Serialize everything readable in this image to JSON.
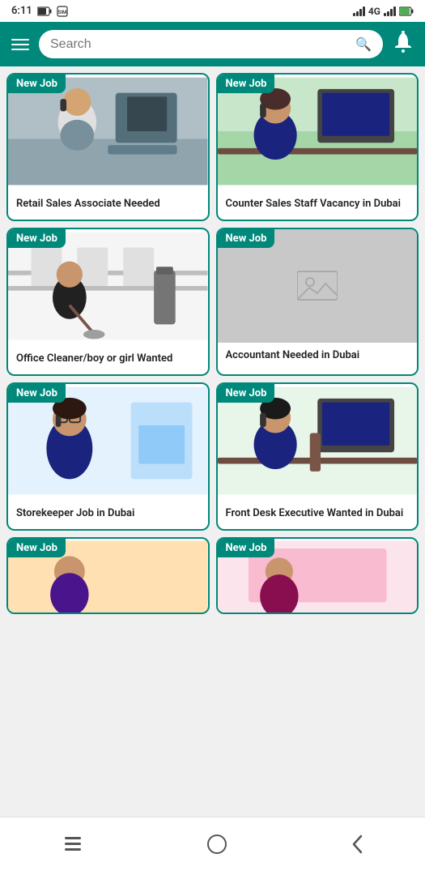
{
  "statusBar": {
    "time": "6:11",
    "signal": "4G"
  },
  "header": {
    "searchPlaceholder": "Search",
    "notificationBell": "bell-icon"
  },
  "jobs": [
    {
      "id": 1,
      "badge": "New Job",
      "title": "Retail Sales Associate Needed",
      "hasImage": true,
      "imageType": "office-phone-man"
    },
    {
      "id": 2,
      "badge": "New Job",
      "title": "Counter Sales Staff Vacancy in Dubai",
      "hasImage": true,
      "imageType": "office-phone-woman"
    },
    {
      "id": 3,
      "badge": "New Job",
      "title": "Office Cleaner/boy or girl Wanted",
      "hasImage": true,
      "imageType": "office-cleaning"
    },
    {
      "id": 4,
      "badge": "New Job",
      "title": "Accountant Needed in Dubai",
      "hasImage": false,
      "imageType": "placeholder"
    },
    {
      "id": 5,
      "badge": "New Job",
      "title": "Storekeeper Job in Dubai",
      "hasImage": true,
      "imageType": "glasses-woman"
    },
    {
      "id": 6,
      "badge": "New Job",
      "title": "Front Desk Executive Wanted in Dubai",
      "hasImage": true,
      "imageType": "frontdesk-woman"
    },
    {
      "id": 7,
      "badge": "New Job",
      "title": "",
      "hasImage": true,
      "imageType": "partial"
    },
    {
      "id": 8,
      "badge": "New Job",
      "title": "",
      "hasImage": true,
      "imageType": "partial"
    }
  ],
  "bottomNav": {
    "menu": "|||",
    "home": "○",
    "back": "‹"
  }
}
